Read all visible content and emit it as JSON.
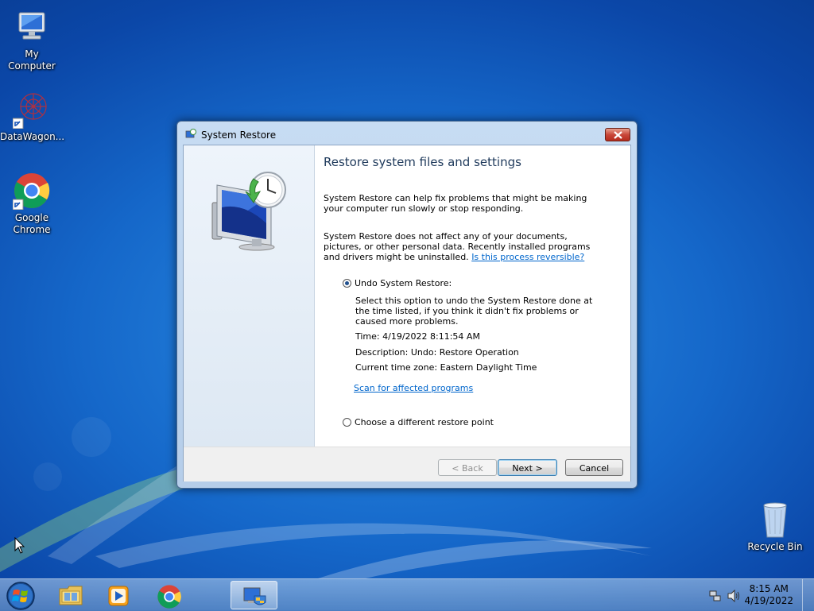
{
  "desktop": {
    "icons": [
      {
        "label": "My Computer",
        "icon": "computer-icon"
      },
      {
        "label": "DataWagon...",
        "icon": "datawagon-icon"
      },
      {
        "label": "Google Chrome",
        "icon": "chrome-icon"
      },
      {
        "label": "Recycle Bin",
        "icon": "recycle-bin-icon"
      }
    ]
  },
  "dialog": {
    "title": "System Restore",
    "heading": "Restore system files and settings",
    "para1": "System Restore can help fix problems that might be making your computer run slowly or stop responding.",
    "para2": "System Restore does not affect any of your documents, pictures, or other personal data. Recently installed programs and drivers might be uninstalled.",
    "para2_link": "Is this process reversible?",
    "option_undo": {
      "label": "Undo System Restore:",
      "selected": true,
      "description": "Select this option to undo the System Restore done at the time listed, if you think it didn't fix problems or caused more problems.",
      "time": "Time: 4/19/2022 8:11:54 AM",
      "desc_line": "Description: Undo: Restore Operation",
      "timezone": "Current time zone: Eastern Daylight Time",
      "scan_link": "Scan for affected programs"
    },
    "option_different": {
      "label": "Choose a different restore point",
      "selected": false
    },
    "buttons": {
      "back": "< Back",
      "next": "Next >",
      "cancel": "Cancel"
    }
  },
  "taskbar": {
    "items": [
      "start-button",
      "file-explorer-icon",
      "media-player-icon",
      "chrome-icon",
      "system-restore-icon"
    ],
    "tray": [
      "network-icon",
      "volume-icon"
    ],
    "clock_time": "8:15 AM",
    "clock_date": "4/19/2022"
  },
  "colors": {
    "accent": "#1e395b",
    "link": "#0066cc",
    "close": "#c9483a"
  }
}
